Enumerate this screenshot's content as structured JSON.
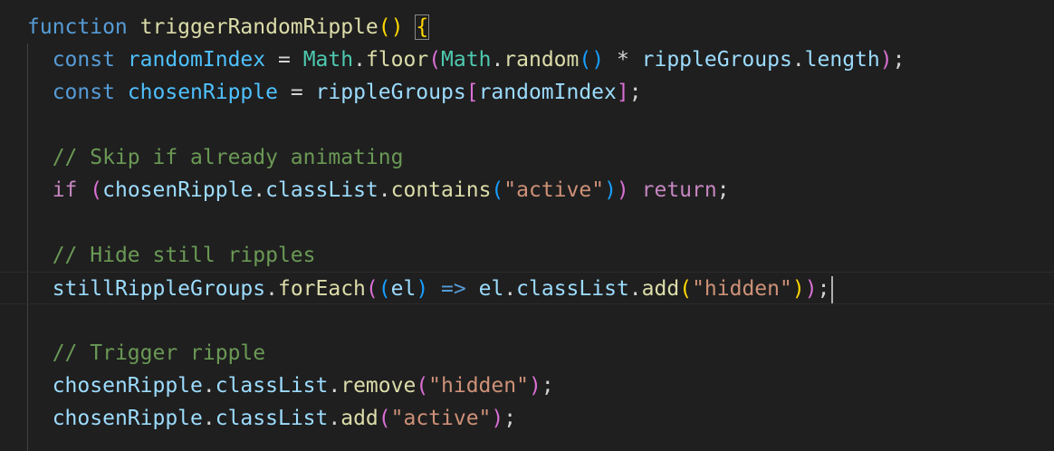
{
  "lines": [
    [
      {
        "t": "function",
        "c": "kw"
      },
      {
        "t": " ",
        "c": "plain"
      },
      {
        "t": "triggerRandomRipple",
        "c": "fn"
      },
      {
        "t": "()",
        "c": "b1"
      },
      {
        "t": " ",
        "c": "plain"
      },
      {
        "t": "{",
        "c": "b1 brace-match"
      }
    ],
    [
      {
        "t": "  ",
        "c": "plain"
      },
      {
        "t": "const",
        "c": "kw"
      },
      {
        "t": " ",
        "c": "plain"
      },
      {
        "t": "randomIndex",
        "c": "const"
      },
      {
        "t": " = ",
        "c": "plain"
      },
      {
        "t": "Math",
        "c": "cls"
      },
      {
        "t": ".",
        "c": "plain"
      },
      {
        "t": "floor",
        "c": "fn"
      },
      {
        "t": "(",
        "c": "b2"
      },
      {
        "t": "Math",
        "c": "cls"
      },
      {
        "t": ".",
        "c": "plain"
      },
      {
        "t": "random",
        "c": "fn"
      },
      {
        "t": "()",
        "c": "b3"
      },
      {
        "t": " * ",
        "c": "plain"
      },
      {
        "t": "rippleGroups",
        "c": "var"
      },
      {
        "t": ".",
        "c": "plain"
      },
      {
        "t": "length",
        "c": "var"
      },
      {
        "t": ")",
        "c": "b2"
      },
      {
        "t": ";",
        "c": "plain"
      }
    ],
    [
      {
        "t": "  ",
        "c": "plain"
      },
      {
        "t": "const",
        "c": "kw"
      },
      {
        "t": " ",
        "c": "plain"
      },
      {
        "t": "chosenRipple",
        "c": "const"
      },
      {
        "t": " = ",
        "c": "plain"
      },
      {
        "t": "rippleGroups",
        "c": "var"
      },
      {
        "t": "[",
        "c": "b2"
      },
      {
        "t": "randomIndex",
        "c": "var"
      },
      {
        "t": "]",
        "c": "b2"
      },
      {
        "t": ";",
        "c": "plain"
      }
    ],
    [],
    [
      {
        "t": "  ",
        "c": "plain"
      },
      {
        "t": "// Skip if already animating",
        "c": "cmt"
      }
    ],
    [
      {
        "t": "  ",
        "c": "plain"
      },
      {
        "t": "if",
        "c": "ctrl"
      },
      {
        "t": " ",
        "c": "plain"
      },
      {
        "t": "(",
        "c": "b2"
      },
      {
        "t": "chosenRipple",
        "c": "var"
      },
      {
        "t": ".",
        "c": "plain"
      },
      {
        "t": "classList",
        "c": "var"
      },
      {
        "t": ".",
        "c": "plain"
      },
      {
        "t": "contains",
        "c": "fn"
      },
      {
        "t": "(",
        "c": "b3"
      },
      {
        "t": "\"active\"",
        "c": "str"
      },
      {
        "t": ")",
        "c": "b3"
      },
      {
        "t": ")",
        "c": "b2"
      },
      {
        "t": " ",
        "c": "plain"
      },
      {
        "t": "return",
        "c": "ctrl"
      },
      {
        "t": ";",
        "c": "plain"
      }
    ],
    [],
    [
      {
        "t": "  ",
        "c": "plain"
      },
      {
        "t": "// Hide still ripples",
        "c": "cmt"
      }
    ],
    [
      {
        "t": "  ",
        "c": "plain"
      },
      {
        "t": "stillRippleGroups",
        "c": "var"
      },
      {
        "t": ".",
        "c": "plain"
      },
      {
        "t": "forEach",
        "c": "fn"
      },
      {
        "t": "(",
        "c": "b2"
      },
      {
        "t": "(",
        "c": "b3"
      },
      {
        "t": "el",
        "c": "var"
      },
      {
        "t": ")",
        "c": "b3"
      },
      {
        "t": " ",
        "c": "plain"
      },
      {
        "t": "=>",
        "c": "kw"
      },
      {
        "t": " ",
        "c": "plain"
      },
      {
        "t": "el",
        "c": "var"
      },
      {
        "t": ".",
        "c": "plain"
      },
      {
        "t": "classList",
        "c": "var"
      },
      {
        "t": ".",
        "c": "plain"
      },
      {
        "t": "add",
        "c": "fn"
      },
      {
        "t": "(",
        "c": "b1"
      },
      {
        "t": "\"hidden\"",
        "c": "str"
      },
      {
        "t": ")",
        "c": "b1"
      },
      {
        "t": ")",
        "c": "b2"
      },
      {
        "t": ";",
        "c": "plain"
      }
    ],
    [],
    [
      {
        "t": "  ",
        "c": "plain"
      },
      {
        "t": "// Trigger ripple",
        "c": "cmt"
      }
    ],
    [
      {
        "t": "  ",
        "c": "plain"
      },
      {
        "t": "chosenRipple",
        "c": "var"
      },
      {
        "t": ".",
        "c": "plain"
      },
      {
        "t": "classList",
        "c": "var"
      },
      {
        "t": ".",
        "c": "plain"
      },
      {
        "t": "remove",
        "c": "fn"
      },
      {
        "t": "(",
        "c": "b2"
      },
      {
        "t": "\"hidden\"",
        "c": "str"
      },
      {
        "t": ")",
        "c": "b2"
      },
      {
        "t": ";",
        "c": "plain"
      }
    ],
    [
      {
        "t": "  ",
        "c": "plain"
      },
      {
        "t": "chosenRipple",
        "c": "var"
      },
      {
        "t": ".",
        "c": "plain"
      },
      {
        "t": "classList",
        "c": "var"
      },
      {
        "t": ".",
        "c": "plain"
      },
      {
        "t": "add",
        "c": "fn"
      },
      {
        "t": "(",
        "c": "b2"
      },
      {
        "t": "\"active\"",
        "c": "str"
      },
      {
        "t": ")",
        "c": "b2"
      },
      {
        "t": ";",
        "c": "plain"
      }
    ]
  ],
  "cursor_line": 8
}
